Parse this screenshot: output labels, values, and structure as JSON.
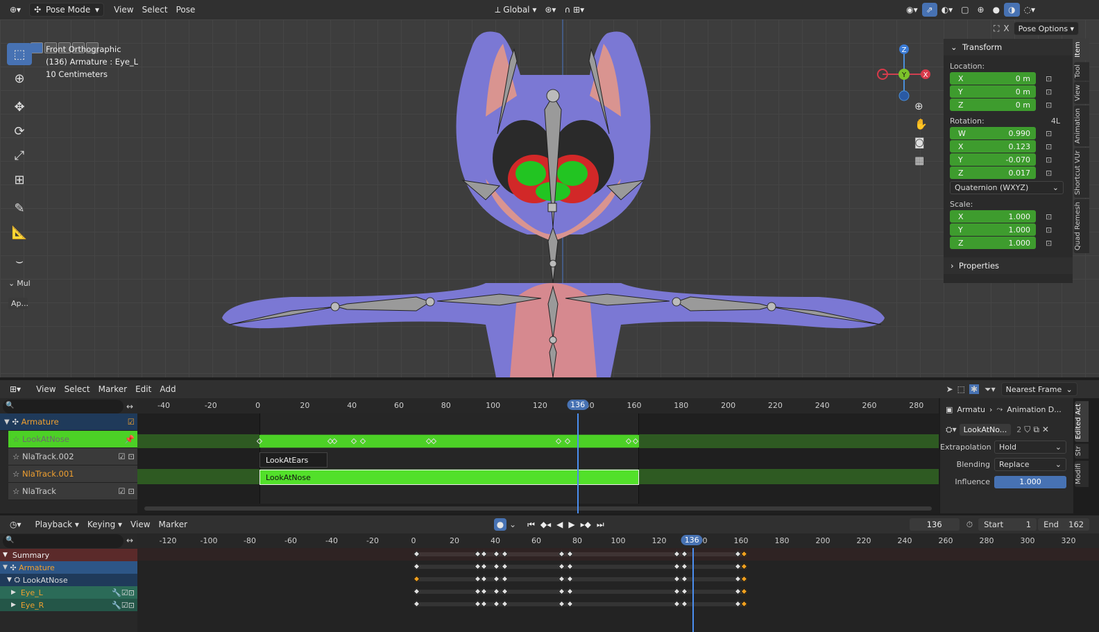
{
  "viewport_header": {
    "mode": "Pose Mode",
    "menus": [
      "View",
      "Select",
      "Pose"
    ],
    "orientation": "Global"
  },
  "viewport": {
    "info": [
      "Front Orthographic",
      "(136) Armature : Eye_L",
      "10 Centimeters"
    ],
    "tool_panel": {
      "label": "Mul",
      "apply": "Ap..."
    },
    "options": "Pose Options",
    "gizmo": {
      "z": "Z",
      "y": "Y",
      "x": "X"
    }
  },
  "transform": {
    "title": "Transform",
    "location_label": "Location:",
    "location": [
      {
        "axis": "X",
        "value": "0 m"
      },
      {
        "axis": "Y",
        "value": "0 m"
      },
      {
        "axis": "Z",
        "value": "0 m"
      }
    ],
    "rotation_label": "Rotation:",
    "rotation_mode_badge": "4L",
    "rotation": [
      {
        "axis": "W",
        "value": "0.990"
      },
      {
        "axis": "X",
        "value": "0.123"
      },
      {
        "axis": "Y",
        "value": "-0.070"
      },
      {
        "axis": "Z",
        "value": "0.017"
      }
    ],
    "rotation_mode": "Quaternion (WXYZ)",
    "scale_label": "Scale:",
    "scale": [
      {
        "axis": "X",
        "value": "1.000"
      },
      {
        "axis": "Y",
        "value": "1.000"
      },
      {
        "axis": "Z",
        "value": "1.000"
      }
    ],
    "properties": "Properties"
  },
  "n_tabs": [
    "Item",
    "Tool",
    "View",
    "Animation",
    "Shortcut VUr",
    "Quad Remesh"
  ],
  "nla": {
    "menus": [
      "View",
      "Select",
      "Marker",
      "Edit",
      "Add"
    ],
    "snap": "Nearest Frame",
    "ticks": [
      "-40",
      "-20",
      "0",
      "20",
      "40",
      "60",
      "80",
      "100",
      "120",
      "140",
      "160",
      "180",
      "200",
      "220",
      "240",
      "260",
      "280"
    ],
    "current_frame": "136",
    "tracks": [
      {
        "name": "Armature"
      },
      {
        "name": "LookAtNose"
      },
      {
        "name": "NlaTrack.002"
      },
      {
        "name": "NlaTrack.001"
      },
      {
        "name": "NlaTrack"
      }
    ],
    "strips": {
      "look_at_ears": "LookAtEars",
      "look_at_nose": "LookAtNose"
    },
    "side": {
      "breadcrumb_a": "Armatu",
      "breadcrumb_b": "Animation D...",
      "action": "LookAtNo...",
      "users": "2",
      "extrapolation_label": "Extrapolation",
      "extrapolation": "Hold",
      "blending_label": "Blending",
      "blending": "Replace",
      "influence_label": "Influence",
      "influence": "1.000"
    },
    "side_tabs": [
      "Edited Act",
      "Str",
      "Modifi"
    ]
  },
  "dopesheet": {
    "menus": [
      "Playback",
      "Keying",
      "View",
      "Marker"
    ],
    "current_frame": "136",
    "start_label": "Start",
    "start": "1",
    "end_label": "End",
    "end": "162",
    "ticks": [
      "-120",
      "-100",
      "-80",
      "-60",
      "-40",
      "-20",
      "0",
      "20",
      "40",
      "60",
      "80",
      "100",
      "120",
      "140",
      "160",
      "180",
      "200",
      "220",
      "240",
      "260",
      "280",
      "300",
      "320"
    ],
    "channels": [
      {
        "name": "Summary"
      },
      {
        "name": "Armature"
      },
      {
        "name": "LookAtNose"
      },
      {
        "name": "Eye_L"
      },
      {
        "name": "Eye_R"
      }
    ]
  },
  "colors": {
    "accent": "#4772b3",
    "strip_green": "#4cd126",
    "field_green": "#3e9c2e",
    "selected_key": "#f0a020"
  }
}
